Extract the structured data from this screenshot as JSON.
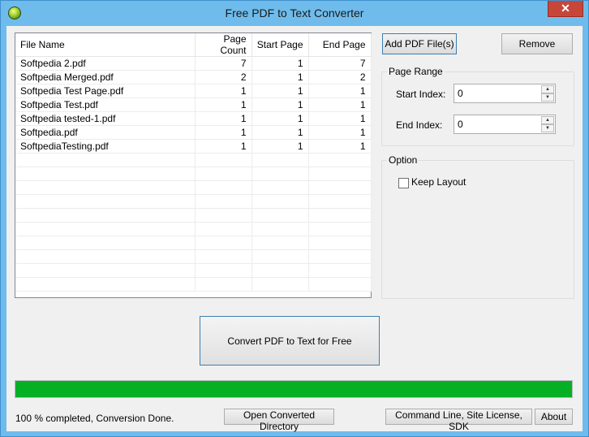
{
  "window": {
    "title": "Free PDF to Text Converter",
    "close_label": "✕"
  },
  "table": {
    "headers": [
      "File Name",
      "Page Count",
      "Start Page",
      "End Page"
    ],
    "rows": [
      [
        "Softpedia 2.pdf",
        "7",
        "1",
        "7"
      ],
      [
        "Softpedia Merged.pdf",
        "2",
        "1",
        "2"
      ],
      [
        "Softpedia Test Page.pdf",
        "1",
        "1",
        "1"
      ],
      [
        "Softpedia Test.pdf",
        "1",
        "1",
        "1"
      ],
      [
        "Softpedia tested-1.pdf",
        "1",
        "1",
        "1"
      ],
      [
        "Softpedia.pdf",
        "1",
        "1",
        "1"
      ],
      [
        "SoftpediaTesting.pdf",
        "1",
        "1",
        "1"
      ]
    ]
  },
  "buttons": {
    "add": "Add PDF File(s)",
    "remove": "Remove",
    "convert": "Convert PDF to Text for Free",
    "open_dir": "Open Converted Directory",
    "cmd": "Command Line, Site License, SDK",
    "about": "About"
  },
  "page_range": {
    "legend": "Page Range",
    "start_label": "Start Index:",
    "start_value": "0",
    "end_label": "End Index:",
    "end_value": "0"
  },
  "option": {
    "legend": "Option",
    "keep_layout": "Keep Layout",
    "keep_layout_checked": false
  },
  "progress": {
    "percent": 100,
    "color": "#06b025"
  },
  "status": "100 % completed, Conversion Done."
}
